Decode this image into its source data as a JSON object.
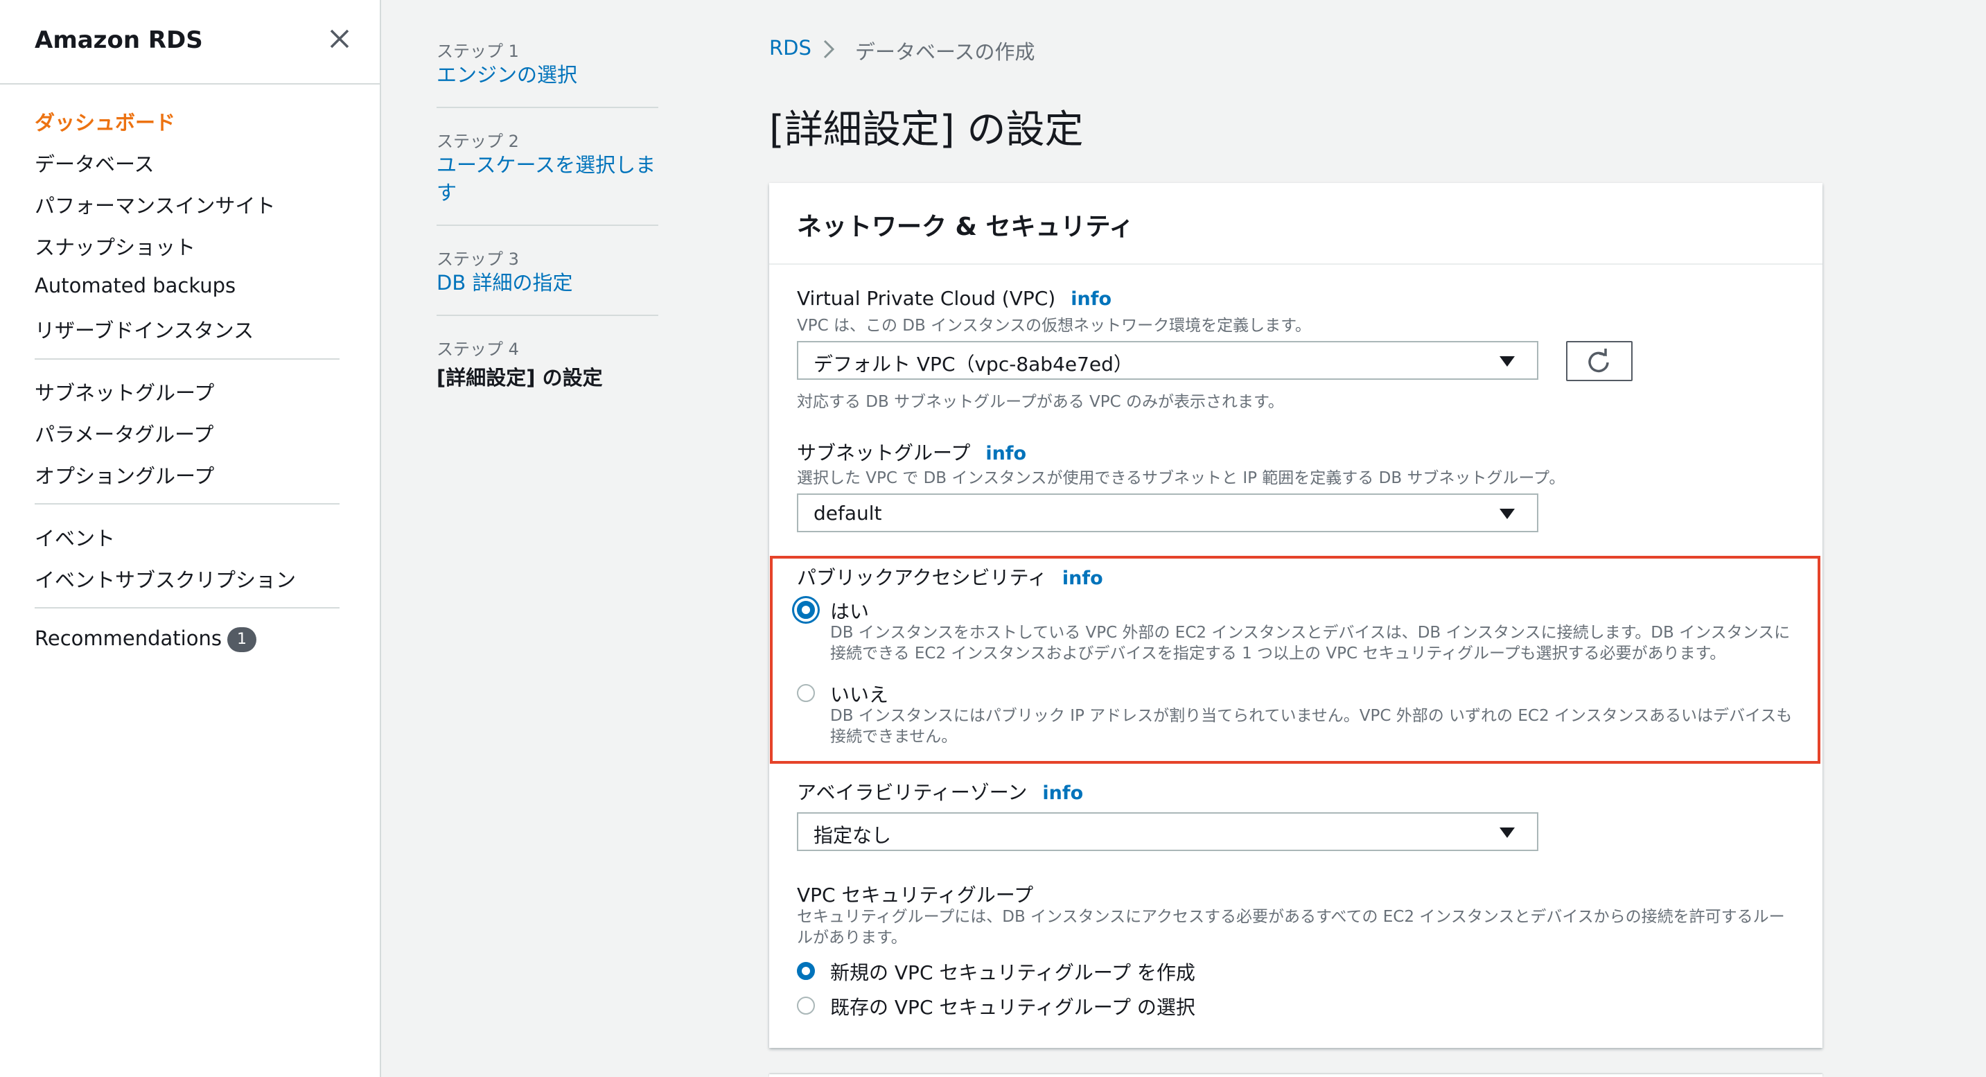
{
  "sidebar": {
    "title": "Amazon RDS",
    "items": [
      {
        "label": "ダッシュボード"
      },
      {
        "label": "データベース"
      },
      {
        "label": "パフォーマンスインサイト"
      },
      {
        "label": "スナップショット"
      },
      {
        "label": "Automated backups"
      },
      {
        "label": "リザーブドインスタンス"
      },
      {
        "label": "サブネットグループ"
      },
      {
        "label": "パラメータグループ"
      },
      {
        "label": "オプショングループ"
      },
      {
        "label": "イベント"
      },
      {
        "label": "イベントサブスクリプション"
      },
      {
        "label": "Recommendations",
        "badge": "1"
      }
    ]
  },
  "steps": [
    {
      "num": "ステップ 1",
      "label": "エンジンの選択"
    },
    {
      "num": "ステップ 2",
      "label": "ユースケースを選択します"
    },
    {
      "num": "ステップ 3",
      "label": "DB 詳細の指定"
    },
    {
      "num": "ステップ 4",
      "label": "[詳細設定] の設定"
    }
  ],
  "breadcrumb": {
    "root": "RDS",
    "current": "データベースの作成"
  },
  "page_title": "[詳細設定] の設定",
  "panel": {
    "title": "ネットワーク & セキュリティ",
    "vpc": {
      "label": "Virtual Private Cloud (VPC)",
      "info": "info",
      "desc": "VPC は、この DB インスタンスの仮想ネットワーク環境を定義します。",
      "value": "デフォルト VPC（vpc-8ab4e7ed）",
      "hint": "対応する DB サブネットグループがある VPC のみが表示されます。"
    },
    "subnet": {
      "label": "サブネットグループ",
      "info": "info",
      "desc": "選択した VPC で DB インスタンスが使用できるサブネットと IP 範囲を定義する DB サブネットグループ。",
      "value": "default"
    },
    "public": {
      "label": "パブリックアクセシビリティ",
      "info": "info",
      "yes_label": "はい",
      "yes_desc": "DB インスタンスをホストしている VPC 外部の EC2 インスタンスとデバイスは、DB インスタンスに接続します。DB インスタンスに接続できる EC2 インスタンスおよびデバイスを指定する 1 つ以上の VPC セキュリティグループも選択する必要があります。",
      "no_label": "いいえ",
      "no_desc": "DB インスタンスにはパブリック IP アドレスが割り当てられていません。VPC 外部の いずれの EC2 インスタンスあるいはデバイスも接続できません。"
    },
    "az": {
      "label": "アベイラビリティーゾーン",
      "info": "info",
      "value": "指定なし"
    },
    "sg": {
      "label": "VPC セキュリティグループ",
      "desc": "セキュリティグループには、DB インスタンスにアクセスする必要があるすべての EC2 インスタンスとデバイスからの接続を許可するルールがあります。",
      "opt_new": "新規の VPC セキュリティグループ を作成",
      "opt_existing": "既存の VPC セキュリティグループ の選択"
    }
  },
  "colors": {
    "accent": "#0073bb",
    "active_nav": "#ec7211",
    "highlight": "#e5432a"
  }
}
